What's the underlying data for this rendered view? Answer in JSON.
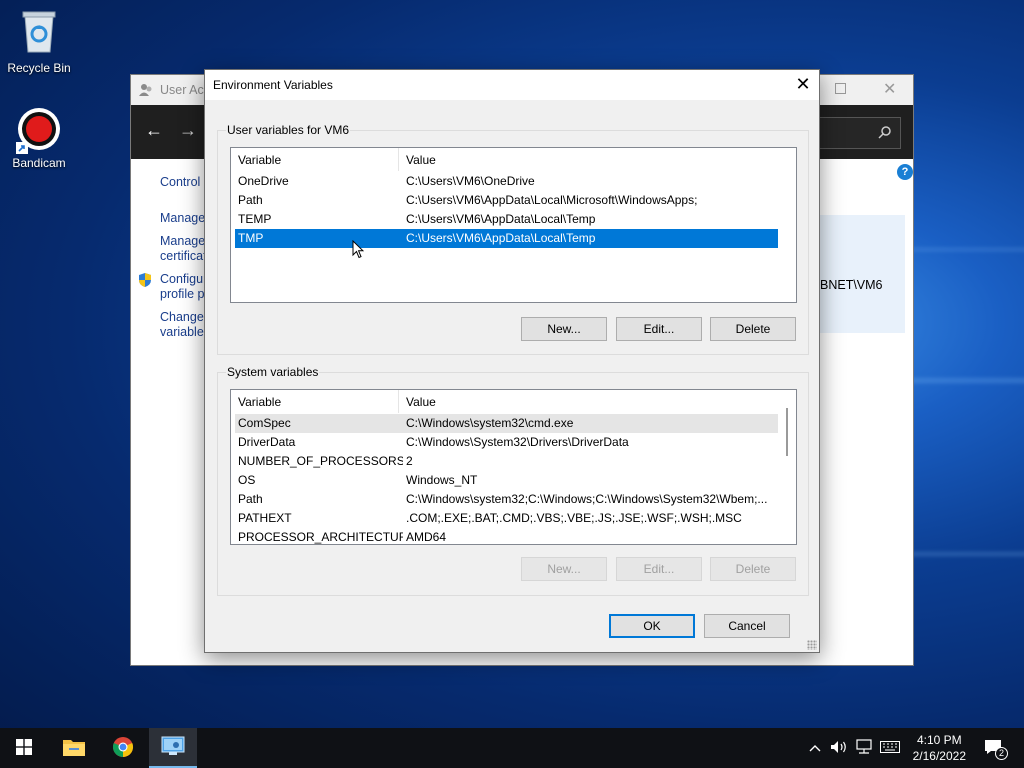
{
  "desktop": {
    "icons": [
      {
        "label": "Recycle Bin"
      },
      {
        "label": "Bandicam"
      }
    ]
  },
  "bg_window": {
    "title": "User Acc",
    "links": [
      "Control P",
      "Manage",
      "Manage",
      "certificat",
      "Configur",
      "profile p",
      "Change",
      "variables"
    ],
    "panel_text": "BNET\\VM6"
  },
  "dialog": {
    "title": "Environment Variables",
    "user_group_label": "User variables for VM6",
    "system_group_label": "System variables",
    "columns": {
      "variable": "Variable",
      "value": "Value"
    },
    "user_vars": [
      {
        "name": "OneDrive",
        "value": "C:\\Users\\VM6\\OneDrive"
      },
      {
        "name": "Path",
        "value": "C:\\Users\\VM6\\AppData\\Local\\Microsoft\\WindowsApps;"
      },
      {
        "name": "TEMP",
        "value": "C:\\Users\\VM6\\AppData\\Local\\Temp"
      },
      {
        "name": "TMP",
        "value": "C:\\Users\\VM6\\AppData\\Local\\Temp"
      }
    ],
    "system_vars": [
      {
        "name": "ComSpec",
        "value": "C:\\Windows\\system32\\cmd.exe"
      },
      {
        "name": "DriverData",
        "value": "C:\\Windows\\System32\\Drivers\\DriverData"
      },
      {
        "name": "NUMBER_OF_PROCESSORS",
        "value": "2"
      },
      {
        "name": "OS",
        "value": "Windows_NT"
      },
      {
        "name": "Path",
        "value": "C:\\Windows\\system32;C:\\Windows;C:\\Windows\\System32\\Wbem;..."
      },
      {
        "name": "PATHEXT",
        "value": ".COM;.EXE;.BAT;.CMD;.VBS;.VBE;.JS;.JSE;.WSF;.WSH;.MSC"
      },
      {
        "name": "PROCESSOR_ARCHITECTURE",
        "value": "AMD64"
      }
    ],
    "buttons": {
      "new": "New...",
      "edit": "Edit...",
      "delete": "Delete",
      "ok": "OK",
      "cancel": "Cancel"
    }
  },
  "taskbar": {
    "time": "4:10 PM",
    "date": "2/16/2022",
    "notification_count": "2"
  },
  "colors": {
    "selection": "#0078d7",
    "taskbar": "#0f1115"
  }
}
